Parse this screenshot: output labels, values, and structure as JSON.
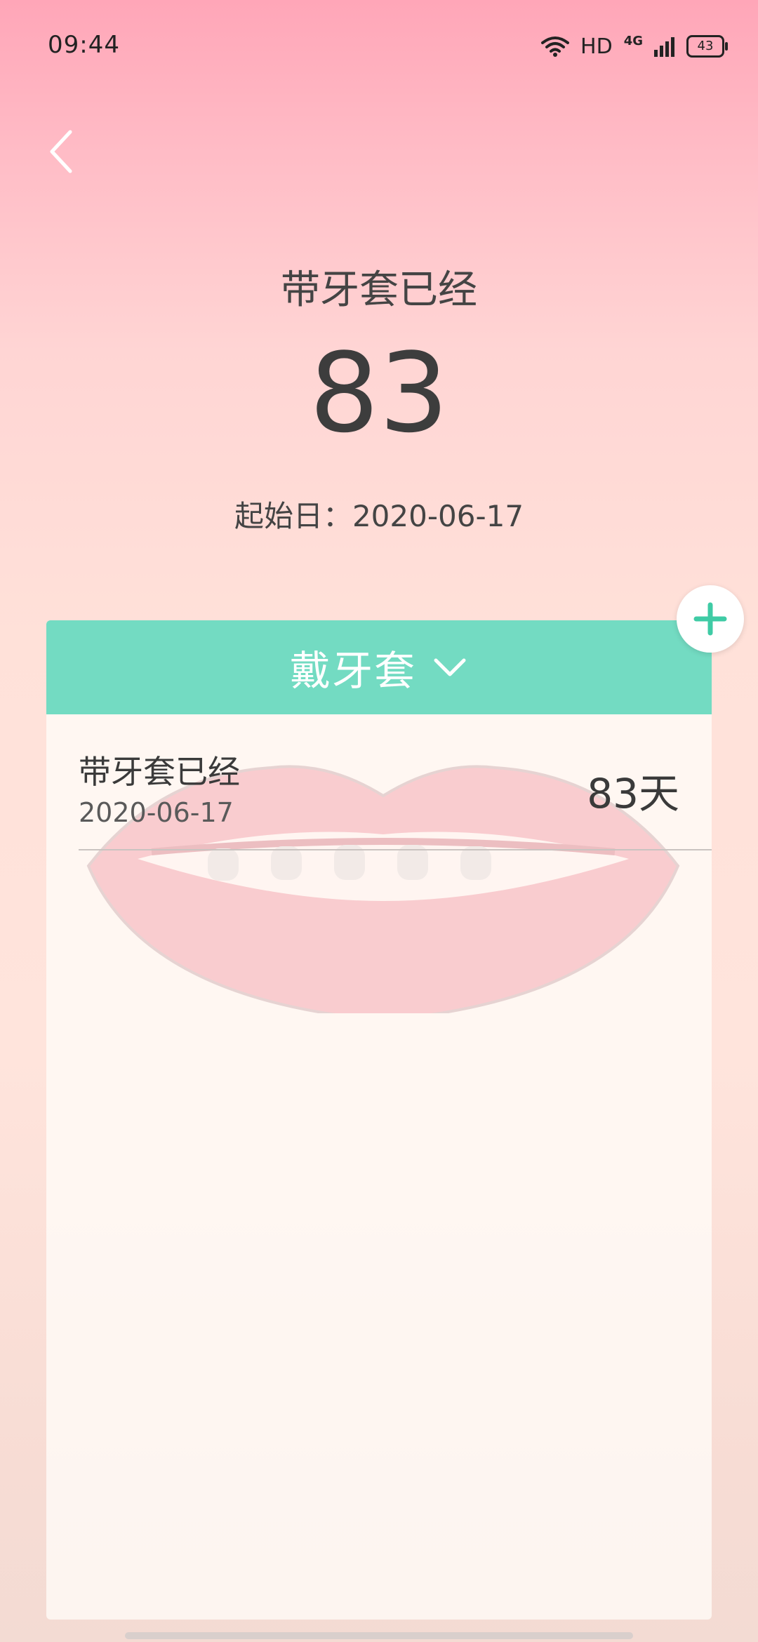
{
  "status_bar": {
    "time": "09:44",
    "network_hd": "HD",
    "network_type": "4G",
    "battery": "43"
  },
  "hero": {
    "title": "带牙套已经",
    "count": "83",
    "start_label": "起始日：2020-06-17"
  },
  "card": {
    "header_title": "戴牙套",
    "items": [
      {
        "title": "带牙套已经",
        "date": "2020-06-17",
        "value": "83天"
      }
    ]
  },
  "colors": {
    "accent": "#73dbc2",
    "text_dark": "#3d3d3d",
    "bg_top": "#ffa6b8",
    "bg_bottom": "#f3dbd3"
  },
  "icons": {
    "back": "chevron-left-icon",
    "dropdown": "chevron-down-icon",
    "add": "plus-icon",
    "wifi": "wifi-icon",
    "signal": "signal-icon",
    "battery": "battery-icon"
  }
}
